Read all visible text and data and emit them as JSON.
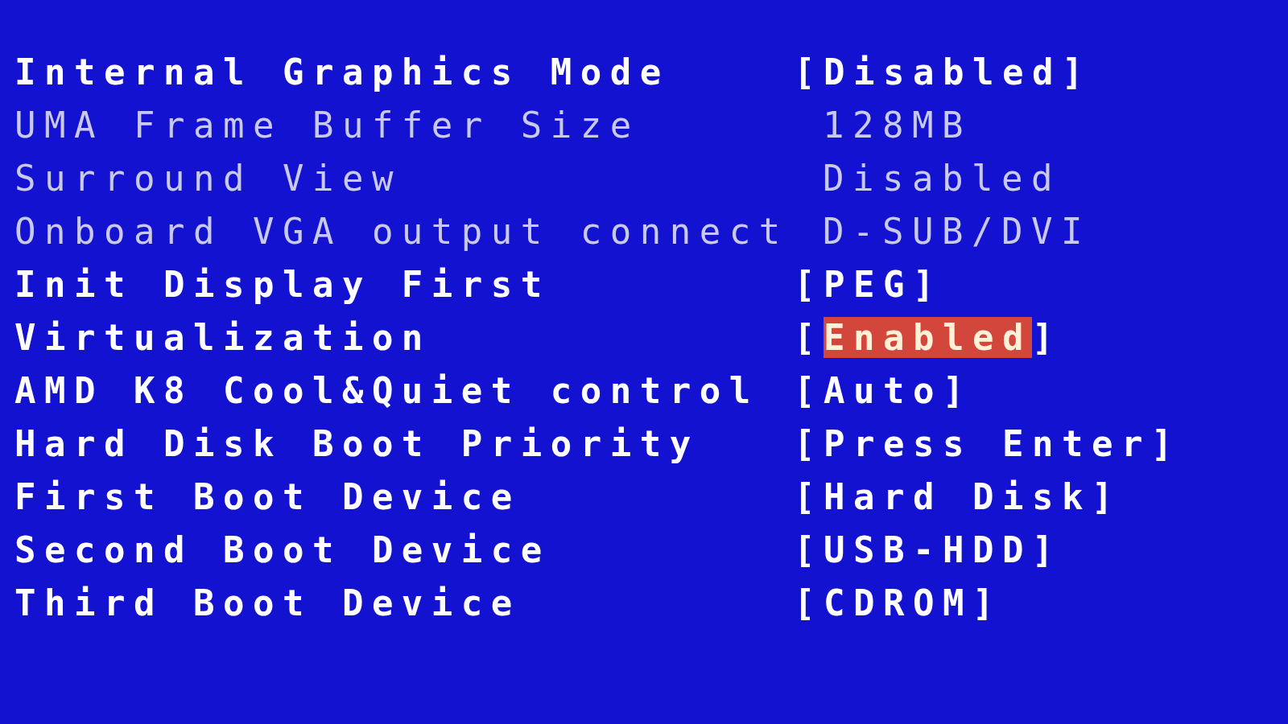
{
  "settings": [
    {
      "label": "Internal Graphics Mode",
      "open": "[",
      "value": "Disabled",
      "close": "]",
      "disabled": false,
      "selected": false
    },
    {
      "label": "UMA Frame Buffer Size",
      "value": "128MB",
      "disabled": true,
      "selected": false
    },
    {
      "label": "Surround View",
      "value": "Disabled",
      "disabled": true,
      "selected": false
    },
    {
      "label": "Onboard VGA output connect",
      "value": "D-SUB/DVI",
      "disabled": true,
      "selected": false
    },
    {
      "label": "Init Display First",
      "open": "[",
      "value": "PEG",
      "close": "]",
      "disabled": false,
      "selected": false
    },
    {
      "label": "Virtualization",
      "open": "[",
      "value": "Enabled",
      "close": "]",
      "disabled": false,
      "selected": true
    },
    {
      "label": "AMD K8 Cool&Quiet control",
      "open": "[",
      "value": "Auto",
      "close": "]",
      "disabled": false,
      "selected": false
    },
    {
      "label": "Hard Disk Boot Priority",
      "open": "[",
      "value": "Press Enter",
      "close": "]",
      "disabled": false,
      "selected": false
    },
    {
      "label": "First Boot Device",
      "open": "[",
      "value": "Hard Disk",
      "close": "]",
      "disabled": false,
      "selected": false
    },
    {
      "label": "Second Boot Device",
      "open": "[",
      "value": "USB-HDD",
      "close": "]",
      "disabled": false,
      "selected": false
    },
    {
      "label": "Third Boot Device",
      "open": "[",
      "value": "CDROM",
      "close": "]",
      "disabled": false,
      "selected": false
    }
  ]
}
